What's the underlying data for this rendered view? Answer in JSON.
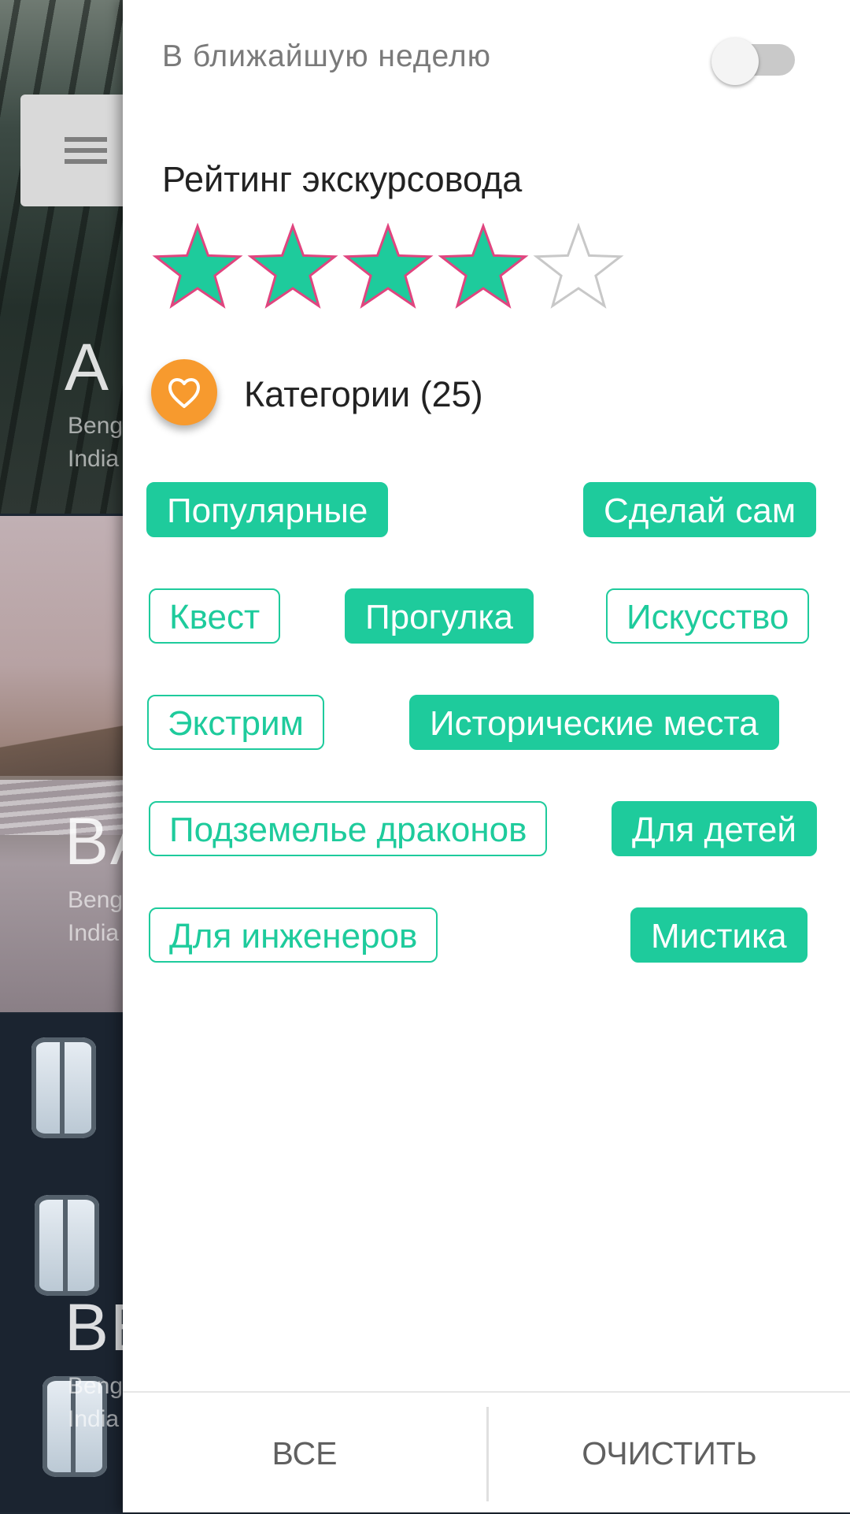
{
  "background_list": {
    "cards": [
      {
        "title": "A",
        "subtitle_line1": "Beng",
        "subtitle_line2": "India"
      },
      {
        "title": "BA",
        "subtitle_line1": "Beng",
        "subtitle_line2": "India"
      },
      {
        "title": "BE",
        "subtitle_line1": "Beng",
        "subtitle_line2": "India"
      }
    ]
  },
  "filters": {
    "next_week": {
      "label": "В ближайшую неделю",
      "enabled": false
    },
    "rating": {
      "label": "Рейтинг экскурсовода",
      "value": 4,
      "max": 5
    },
    "categories": {
      "title": "Категории (25)",
      "icon": "heart-icon",
      "chips": [
        {
          "label": "Популярные",
          "selected": true
        },
        {
          "label": "Сделай сам",
          "selected": true
        },
        {
          "label": "Квест",
          "selected": false
        },
        {
          "label": "Прогулка",
          "selected": true
        },
        {
          "label": "Искусство",
          "selected": false
        },
        {
          "label": "Экстрим",
          "selected": false
        },
        {
          "label": "Исторические места",
          "selected": true
        },
        {
          "label": "Подземелье драконов",
          "selected": false
        },
        {
          "label": "Для детей",
          "selected": true
        },
        {
          "label": "Для инженеров",
          "selected": false
        },
        {
          "label": "Мистика",
          "selected": true
        }
      ]
    }
  },
  "footer": {
    "all_label": "ВСЕ",
    "clear_label": "ОЧИСТИТЬ"
  },
  "colors": {
    "accent": "#1ecb9c",
    "star_outline": "#e0457f",
    "category_icon": "#f79a2e",
    "empty_star": "#c8c8c8"
  }
}
